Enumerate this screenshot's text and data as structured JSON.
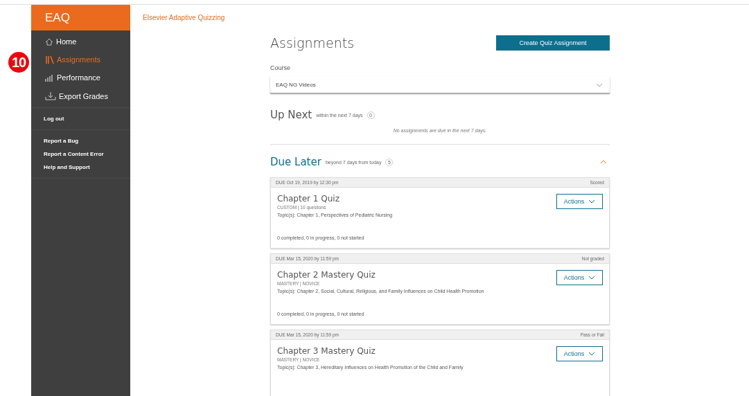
{
  "callout": {
    "label": "10"
  },
  "sidebar": {
    "logo": "EAQ",
    "nav": [
      {
        "label": "Home",
        "selected": false
      },
      {
        "label": "Assignments",
        "selected": true
      },
      {
        "label": "Performance",
        "selected": false
      },
      {
        "label": "Export Grades",
        "selected": false
      }
    ],
    "account": [
      "Log out"
    ],
    "links": [
      "Report a Bug",
      "Report a Content Error",
      "Help and Support"
    ]
  },
  "header": {
    "title": "Elsevier Adaptive Quizzing"
  },
  "page": {
    "title": "Assignments",
    "create_button": "Create Quiz Assignment",
    "course": {
      "label": "Course",
      "value": "EAQ NG Videos"
    },
    "up_next": {
      "title": "Up Next",
      "hint": "within the next 7 days",
      "count": "0",
      "empty": "No assignments are due in the next 7 days."
    },
    "due_later": {
      "title": "Due Later",
      "hint": "beyond 7 days from today",
      "count": "5",
      "expanded": true,
      "items": [
        {
          "due": "DUE Oct 19, 2019 by 12:30 pm",
          "grading": "Scored",
          "title": "Chapter 1 Quiz",
          "meta": "CUSTOM | 10 questions",
          "topics": "Topic(s): Chapter 1, Perspectives of Pediatric Nursing",
          "actions": "Actions",
          "progress": "0 completed, 0 in progress, 0 not started"
        },
        {
          "due": "DUE Mar 15, 2020 by 11:59 pm",
          "grading": "Not graded",
          "title": "Chapter 2 Mastery Quiz",
          "meta": "MASTERY | NOVICE",
          "topics": "Topic(s): Chapter 2, Social, Cultural, Religious, and Family Influences on Child Health Promotion",
          "actions": "Actions",
          "progress": "0 completed, 0 in progress, 0 not started"
        },
        {
          "due": "DUE Mar 15, 2020 by 11:59 pm",
          "grading": "Pass or Fail",
          "title": "Chapter 3 Mastery Quiz",
          "meta": "MASTERY | NOVICE",
          "topics": "Topic(s): Chapter 3, Hereditary Influences on Health Promotion of the Child and Family",
          "actions": "Actions"
        }
      ]
    }
  }
}
